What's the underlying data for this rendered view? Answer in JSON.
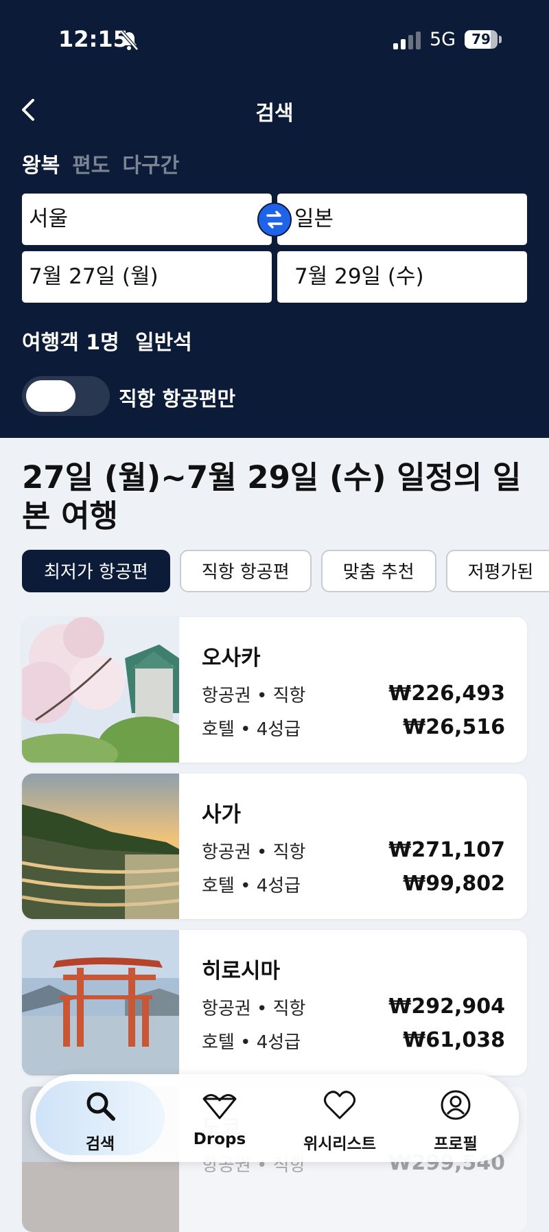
{
  "status_bar": {
    "time": "12:15",
    "network": "5G",
    "battery": "79",
    "battery_level": 0.79
  },
  "header": {
    "title": "검색"
  },
  "trip_types": [
    {
      "label": "왕복",
      "active": true
    },
    {
      "label": "편도",
      "active": false
    },
    {
      "label": "다구간",
      "active": false
    }
  ],
  "search": {
    "origin": "서울",
    "destination": "일본",
    "depart_date": "7월 27일 (월)",
    "return_date": "7월 29일 (수)",
    "passengers": "여행객 1명",
    "cabin_class": "일반석",
    "direct_only_label": "직항 항공편만",
    "direct_only": false
  },
  "results": {
    "heading": "27일 (월)~7월 29일 (수) 일정의 일본 여행",
    "filters": [
      {
        "label": "최저가 항공편",
        "active": true
      },
      {
        "label": "직항 항공편",
        "active": false
      },
      {
        "label": "맞춤 추천",
        "active": false
      },
      {
        "label": "저평가된",
        "active": false
      }
    ],
    "destinations": [
      {
        "city": "오사카",
        "flight_label": "항공권 • 직항",
        "flight_price": "₩226,493",
        "hotel_label": "호텔 • 4성급",
        "hotel_price": "₩26,516"
      },
      {
        "city": "사가",
        "flight_label": "항공권 • 직항",
        "flight_price": "₩271,107",
        "hotel_label": "호텔 • 4성급",
        "hotel_price": "₩99,802"
      },
      {
        "city": "히로시마",
        "flight_label": "항공권 • 직항",
        "flight_price": "₩292,904",
        "hotel_label": "호텔 • 4성급",
        "hotel_price": "₩61,038"
      },
      {
        "city": "도쿄",
        "flight_label": "항공권 • 직항",
        "flight_price": "₩299,540",
        "hotel_label": "",
        "hotel_price": ""
      }
    ]
  },
  "bottom_nav": [
    {
      "label": "검색",
      "icon": "search-icon",
      "active": true
    },
    {
      "label": "Drops",
      "icon": "drops-icon",
      "active": false
    },
    {
      "label": "위시리스트",
      "icon": "heart-icon",
      "active": false
    },
    {
      "label": "프로필",
      "icon": "profile-icon",
      "active": false
    }
  ],
  "colors": {
    "header_bg": "#0c1c38",
    "accent": "#1f63ea",
    "page_bg": "#eef1f6"
  }
}
